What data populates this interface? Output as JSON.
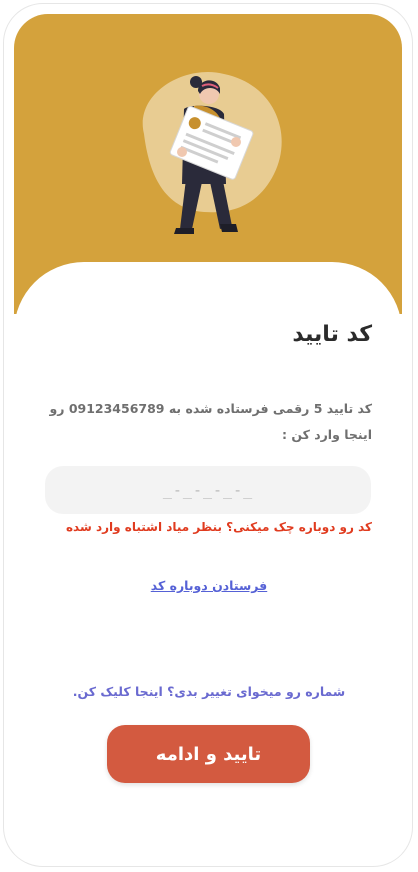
{
  "screen": {
    "title": "کد تایید",
    "description": "کد تایید 5 رقمی فرستاده شده به 09123456789 رو اینجا وارد کن :",
    "code_input": {
      "value": "",
      "placeholder": "_-_-_-_-_"
    },
    "error_message": "کد رو دوباره چک میکنی؟ بنظر میاد اشتباه وارد شده",
    "resend_link": "فرستادن دوباره کد",
    "change_number_link": "شماره رو میخوای تغییر بدی؟ اینجا کلیک کن.",
    "confirm_button": "تایید و ادامه"
  },
  "colors": {
    "hero_background": "#d4a23c",
    "error": "#e03b1f",
    "link": "#5561d6",
    "button": "#d35a40"
  },
  "icons": {
    "hero": "woman-holding-document-illustration"
  }
}
